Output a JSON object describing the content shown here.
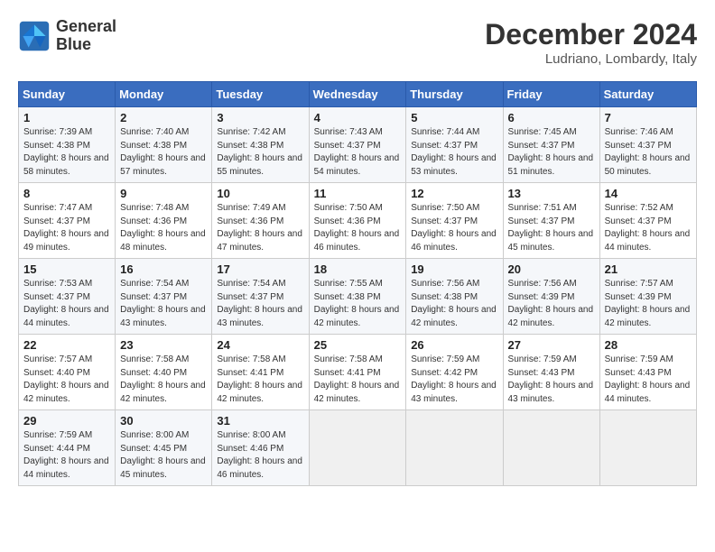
{
  "header": {
    "logo_line1": "General",
    "logo_line2": "Blue",
    "month": "December 2024",
    "location": "Ludriano, Lombardy, Italy"
  },
  "weekdays": [
    "Sunday",
    "Monday",
    "Tuesday",
    "Wednesday",
    "Thursday",
    "Friday",
    "Saturday"
  ],
  "weeks": [
    [
      {
        "day": "1",
        "sunrise": "7:39 AM",
        "sunset": "4:38 PM",
        "daylight": "8 hours and 58 minutes."
      },
      {
        "day": "2",
        "sunrise": "7:40 AM",
        "sunset": "4:38 PM",
        "daylight": "8 hours and 57 minutes."
      },
      {
        "day": "3",
        "sunrise": "7:42 AM",
        "sunset": "4:38 PM",
        "daylight": "8 hours and 55 minutes."
      },
      {
        "day": "4",
        "sunrise": "7:43 AM",
        "sunset": "4:37 PM",
        "daylight": "8 hours and 54 minutes."
      },
      {
        "day": "5",
        "sunrise": "7:44 AM",
        "sunset": "4:37 PM",
        "daylight": "8 hours and 53 minutes."
      },
      {
        "day": "6",
        "sunrise": "7:45 AM",
        "sunset": "4:37 PM",
        "daylight": "8 hours and 51 minutes."
      },
      {
        "day": "7",
        "sunrise": "7:46 AM",
        "sunset": "4:37 PM",
        "daylight": "8 hours and 50 minutes."
      }
    ],
    [
      {
        "day": "8",
        "sunrise": "7:47 AM",
        "sunset": "4:37 PM",
        "daylight": "8 hours and 49 minutes."
      },
      {
        "day": "9",
        "sunrise": "7:48 AM",
        "sunset": "4:36 PM",
        "daylight": "8 hours and 48 minutes."
      },
      {
        "day": "10",
        "sunrise": "7:49 AM",
        "sunset": "4:36 PM",
        "daylight": "8 hours and 47 minutes."
      },
      {
        "day": "11",
        "sunrise": "7:50 AM",
        "sunset": "4:36 PM",
        "daylight": "8 hours and 46 minutes."
      },
      {
        "day": "12",
        "sunrise": "7:50 AM",
        "sunset": "4:37 PM",
        "daylight": "8 hours and 46 minutes."
      },
      {
        "day": "13",
        "sunrise": "7:51 AM",
        "sunset": "4:37 PM",
        "daylight": "8 hours and 45 minutes."
      },
      {
        "day": "14",
        "sunrise": "7:52 AM",
        "sunset": "4:37 PM",
        "daylight": "8 hours and 44 minutes."
      }
    ],
    [
      {
        "day": "15",
        "sunrise": "7:53 AM",
        "sunset": "4:37 PM",
        "daylight": "8 hours and 44 minutes."
      },
      {
        "day": "16",
        "sunrise": "7:54 AM",
        "sunset": "4:37 PM",
        "daylight": "8 hours and 43 minutes."
      },
      {
        "day": "17",
        "sunrise": "7:54 AM",
        "sunset": "4:37 PM",
        "daylight": "8 hours and 43 minutes."
      },
      {
        "day": "18",
        "sunrise": "7:55 AM",
        "sunset": "4:38 PM",
        "daylight": "8 hours and 42 minutes."
      },
      {
        "day": "19",
        "sunrise": "7:56 AM",
        "sunset": "4:38 PM",
        "daylight": "8 hours and 42 minutes."
      },
      {
        "day": "20",
        "sunrise": "7:56 AM",
        "sunset": "4:39 PM",
        "daylight": "8 hours and 42 minutes."
      },
      {
        "day": "21",
        "sunrise": "7:57 AM",
        "sunset": "4:39 PM",
        "daylight": "8 hours and 42 minutes."
      }
    ],
    [
      {
        "day": "22",
        "sunrise": "7:57 AM",
        "sunset": "4:40 PM",
        "daylight": "8 hours and 42 minutes."
      },
      {
        "day": "23",
        "sunrise": "7:58 AM",
        "sunset": "4:40 PM",
        "daylight": "8 hours and 42 minutes."
      },
      {
        "day": "24",
        "sunrise": "7:58 AM",
        "sunset": "4:41 PM",
        "daylight": "8 hours and 42 minutes."
      },
      {
        "day": "25",
        "sunrise": "7:58 AM",
        "sunset": "4:41 PM",
        "daylight": "8 hours and 42 minutes."
      },
      {
        "day": "26",
        "sunrise": "7:59 AM",
        "sunset": "4:42 PM",
        "daylight": "8 hours and 43 minutes."
      },
      {
        "day": "27",
        "sunrise": "7:59 AM",
        "sunset": "4:43 PM",
        "daylight": "8 hours and 43 minutes."
      },
      {
        "day": "28",
        "sunrise": "7:59 AM",
        "sunset": "4:43 PM",
        "daylight": "8 hours and 44 minutes."
      }
    ],
    [
      {
        "day": "29",
        "sunrise": "7:59 AM",
        "sunset": "4:44 PM",
        "daylight": "8 hours and 44 minutes."
      },
      {
        "day": "30",
        "sunrise": "8:00 AM",
        "sunset": "4:45 PM",
        "daylight": "8 hours and 45 minutes."
      },
      {
        "day": "31",
        "sunrise": "8:00 AM",
        "sunset": "4:46 PM",
        "daylight": "8 hours and 46 minutes."
      },
      null,
      null,
      null,
      null
    ]
  ]
}
